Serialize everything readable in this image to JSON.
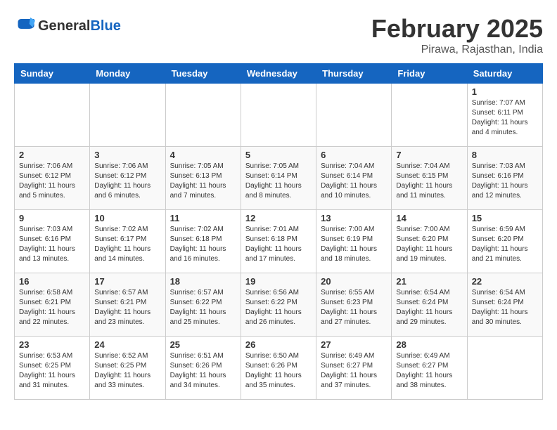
{
  "header": {
    "logo": {
      "general": "General",
      "blue": "Blue"
    },
    "title": "February 2025",
    "subtitle": "Pirawa, Rajasthan, India"
  },
  "days_of_week": [
    "Sunday",
    "Monday",
    "Tuesday",
    "Wednesday",
    "Thursday",
    "Friday",
    "Saturday"
  ],
  "weeks": [
    [
      {
        "day": "",
        "info": ""
      },
      {
        "day": "",
        "info": ""
      },
      {
        "day": "",
        "info": ""
      },
      {
        "day": "",
        "info": ""
      },
      {
        "day": "",
        "info": ""
      },
      {
        "day": "",
        "info": ""
      },
      {
        "day": "1",
        "info": "Sunrise: 7:07 AM\nSunset: 6:11 PM\nDaylight: 11 hours and 4 minutes."
      }
    ],
    [
      {
        "day": "2",
        "info": "Sunrise: 7:06 AM\nSunset: 6:12 PM\nDaylight: 11 hours and 5 minutes."
      },
      {
        "day": "3",
        "info": "Sunrise: 7:06 AM\nSunset: 6:12 PM\nDaylight: 11 hours and 6 minutes."
      },
      {
        "day": "4",
        "info": "Sunrise: 7:05 AM\nSunset: 6:13 PM\nDaylight: 11 hours and 7 minutes."
      },
      {
        "day": "5",
        "info": "Sunrise: 7:05 AM\nSunset: 6:14 PM\nDaylight: 11 hours and 8 minutes."
      },
      {
        "day": "6",
        "info": "Sunrise: 7:04 AM\nSunset: 6:14 PM\nDaylight: 11 hours and 10 minutes."
      },
      {
        "day": "7",
        "info": "Sunrise: 7:04 AM\nSunset: 6:15 PM\nDaylight: 11 hours and 11 minutes."
      },
      {
        "day": "8",
        "info": "Sunrise: 7:03 AM\nSunset: 6:16 PM\nDaylight: 11 hours and 12 minutes."
      }
    ],
    [
      {
        "day": "9",
        "info": "Sunrise: 7:03 AM\nSunset: 6:16 PM\nDaylight: 11 hours and 13 minutes."
      },
      {
        "day": "10",
        "info": "Sunrise: 7:02 AM\nSunset: 6:17 PM\nDaylight: 11 hours and 14 minutes."
      },
      {
        "day": "11",
        "info": "Sunrise: 7:02 AM\nSunset: 6:18 PM\nDaylight: 11 hours and 16 minutes."
      },
      {
        "day": "12",
        "info": "Sunrise: 7:01 AM\nSunset: 6:18 PM\nDaylight: 11 hours and 17 minutes."
      },
      {
        "day": "13",
        "info": "Sunrise: 7:00 AM\nSunset: 6:19 PM\nDaylight: 11 hours and 18 minutes."
      },
      {
        "day": "14",
        "info": "Sunrise: 7:00 AM\nSunset: 6:20 PM\nDaylight: 11 hours and 19 minutes."
      },
      {
        "day": "15",
        "info": "Sunrise: 6:59 AM\nSunset: 6:20 PM\nDaylight: 11 hours and 21 minutes."
      }
    ],
    [
      {
        "day": "16",
        "info": "Sunrise: 6:58 AM\nSunset: 6:21 PM\nDaylight: 11 hours and 22 minutes."
      },
      {
        "day": "17",
        "info": "Sunrise: 6:57 AM\nSunset: 6:21 PM\nDaylight: 11 hours and 23 minutes."
      },
      {
        "day": "18",
        "info": "Sunrise: 6:57 AM\nSunset: 6:22 PM\nDaylight: 11 hours and 25 minutes."
      },
      {
        "day": "19",
        "info": "Sunrise: 6:56 AM\nSunset: 6:22 PM\nDaylight: 11 hours and 26 minutes."
      },
      {
        "day": "20",
        "info": "Sunrise: 6:55 AM\nSunset: 6:23 PM\nDaylight: 11 hours and 27 minutes."
      },
      {
        "day": "21",
        "info": "Sunrise: 6:54 AM\nSunset: 6:24 PM\nDaylight: 11 hours and 29 minutes."
      },
      {
        "day": "22",
        "info": "Sunrise: 6:54 AM\nSunset: 6:24 PM\nDaylight: 11 hours and 30 minutes."
      }
    ],
    [
      {
        "day": "23",
        "info": "Sunrise: 6:53 AM\nSunset: 6:25 PM\nDaylight: 11 hours and 31 minutes."
      },
      {
        "day": "24",
        "info": "Sunrise: 6:52 AM\nSunset: 6:25 PM\nDaylight: 11 hours and 33 minutes."
      },
      {
        "day": "25",
        "info": "Sunrise: 6:51 AM\nSunset: 6:26 PM\nDaylight: 11 hours and 34 minutes."
      },
      {
        "day": "26",
        "info": "Sunrise: 6:50 AM\nSunset: 6:26 PM\nDaylight: 11 hours and 35 minutes."
      },
      {
        "day": "27",
        "info": "Sunrise: 6:49 AM\nSunset: 6:27 PM\nDaylight: 11 hours and 37 minutes."
      },
      {
        "day": "28",
        "info": "Sunrise: 6:49 AM\nSunset: 6:27 PM\nDaylight: 11 hours and 38 minutes."
      },
      {
        "day": "",
        "info": ""
      }
    ]
  ]
}
